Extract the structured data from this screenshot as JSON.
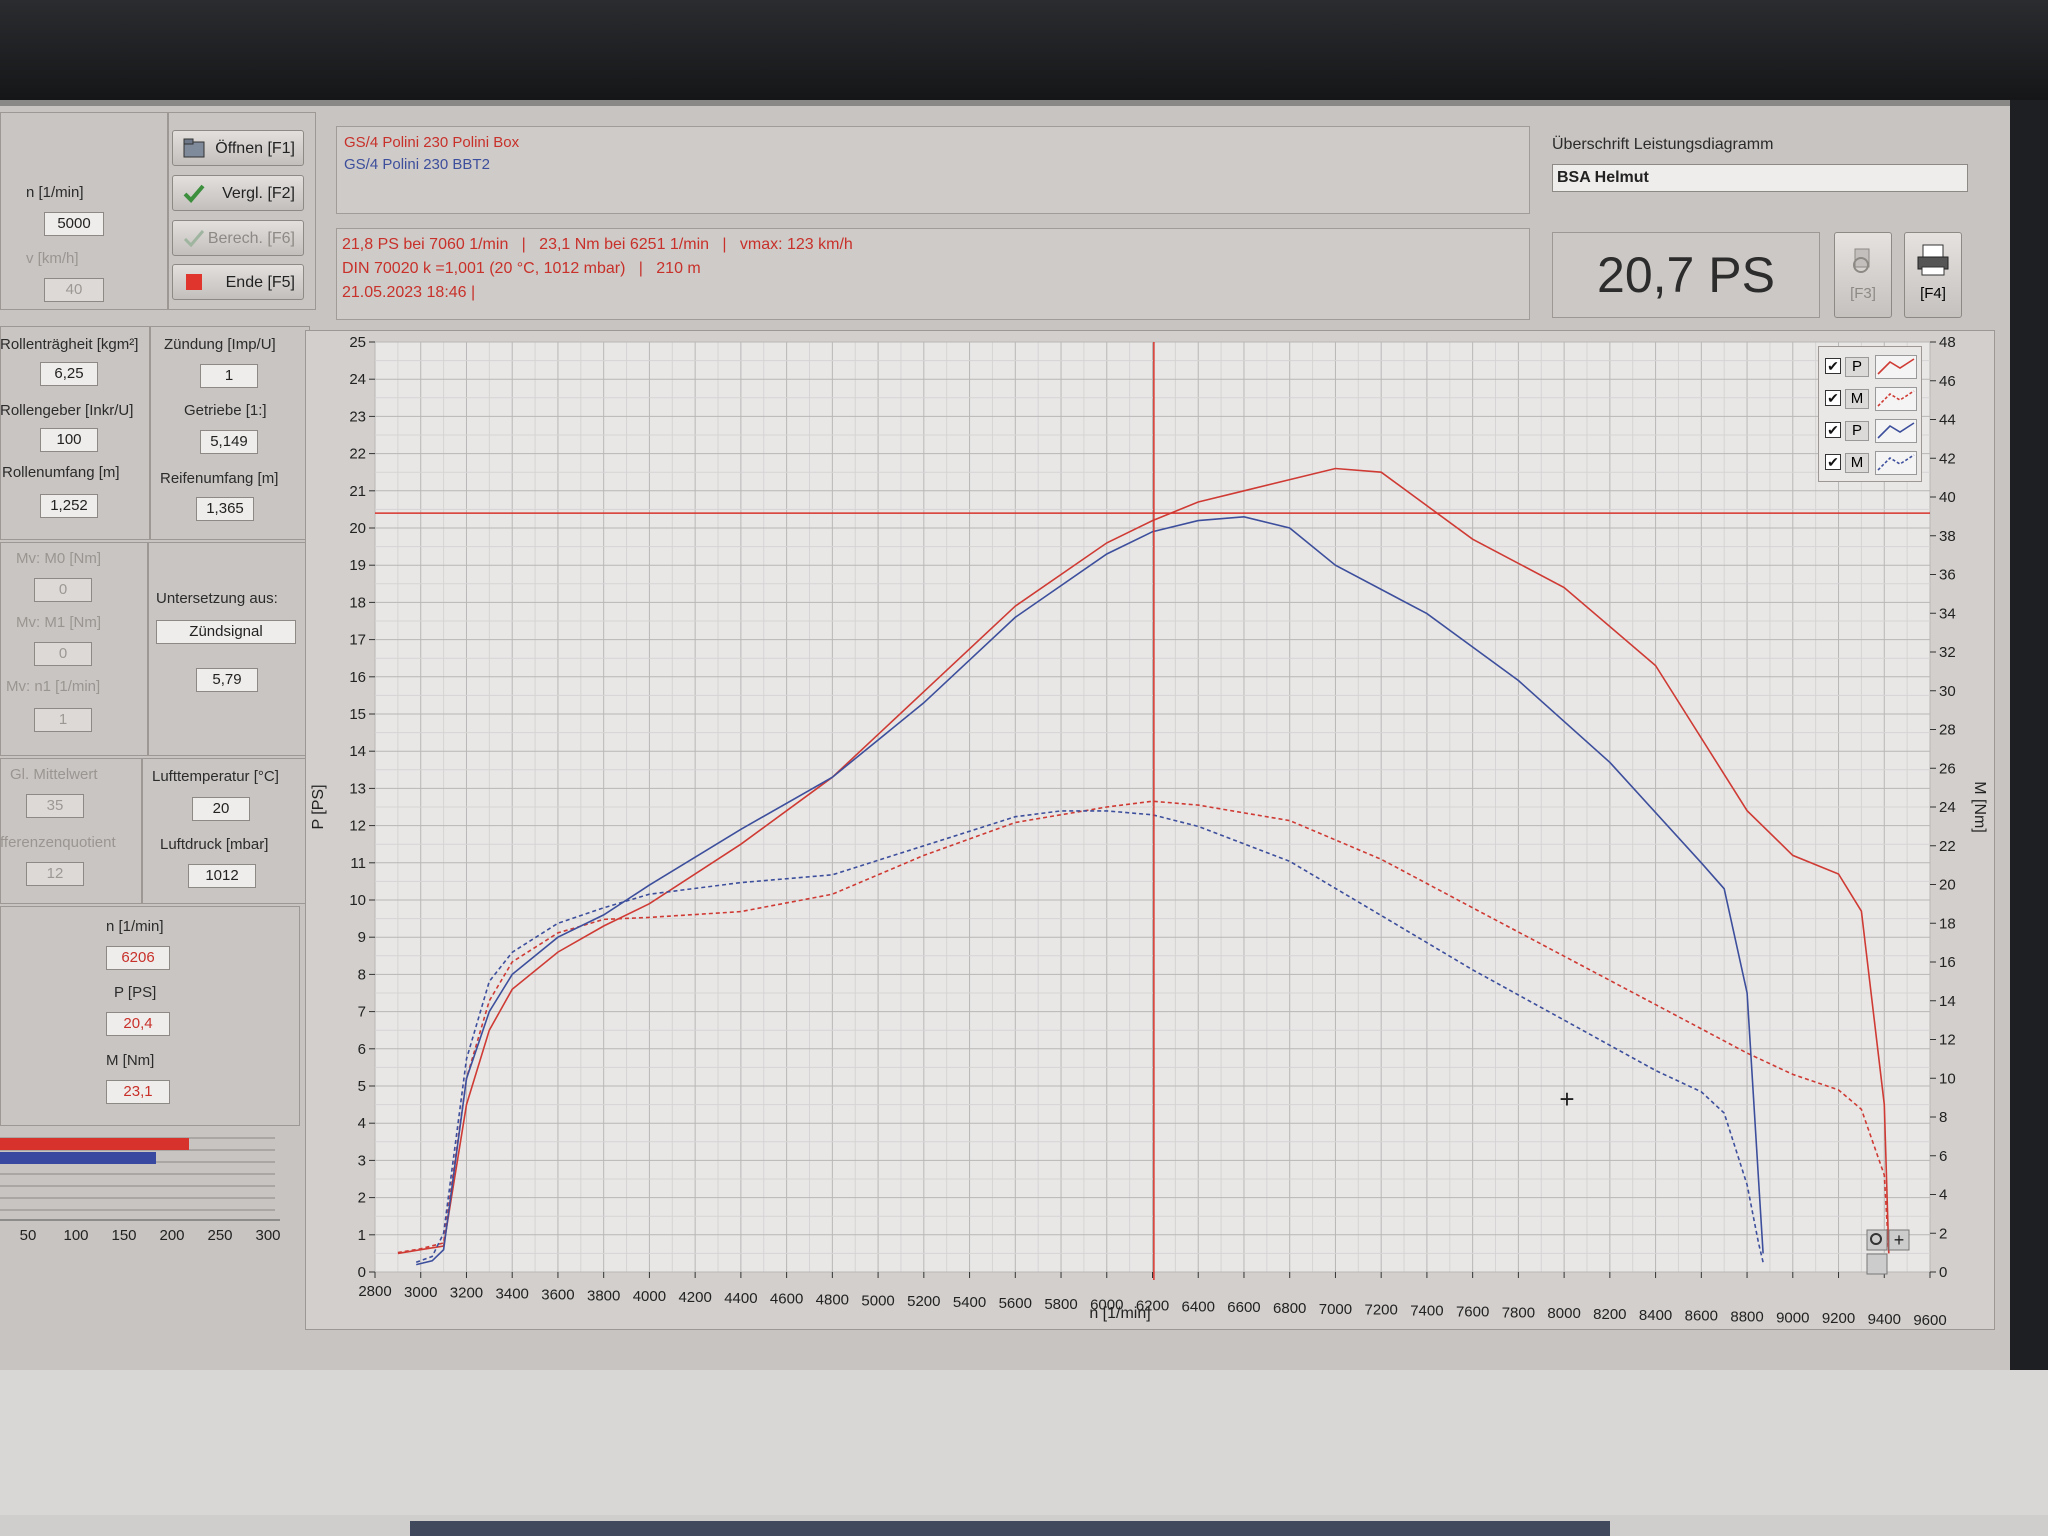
{
  "left": {
    "n_label": "n [1/min]",
    "n_value": "5000",
    "v_label": "v [km/h]",
    "v_value": "40",
    "buttons": {
      "open": "Öffnen [F1]",
      "compare": "Vergl. [F2]",
      "calc": "Berech. [F6]",
      "end": "Ende [F5]"
    },
    "params": {
      "roll_inertia_label": "Rollenträgheit [kgm²]",
      "roll_inertia": "6,25",
      "roll_encoder_label": "Rollengeber [Inkr/U]",
      "roll_encoder": "100",
      "roll_circ_label": "Rollenumfang [m]",
      "roll_circ": "1,252",
      "ignition_label": "Zündung [Imp/U]",
      "ignition": "1",
      "gearbox_label": "Getriebe [1:]",
      "gearbox": "5,149",
      "tire_circ_label": "Reifenumfang [m]",
      "tire_circ": "1,365",
      "mv_m0_label": "Mv: M0 [Nm]",
      "mv_m0": "0",
      "mv_m1_label": "Mv: M1 [Nm]",
      "mv_m1": "0",
      "mv_n1_label": "Mv: n1 [1/min]",
      "mv_n1": "1",
      "reduction_label": "Untersetzung aus:",
      "reduction_source": "Zündsignal",
      "reduction_value": "5,79",
      "gl_mean_label": "Gl. Mittelwert",
      "gl_mean": "35",
      "diff_quot_label": "fferenzenquotient",
      "diff_quot": "12",
      "air_temp_label": "Lufttemperatur [°C]",
      "air_temp": "20",
      "air_press_label": "Luftdruck [mbar]",
      "air_press": "1012"
    },
    "cursor": {
      "n_label": "n [1/min]",
      "n": "6206",
      "p_label": "P [PS]",
      "p": "20,4",
      "m_label": "M [Nm]",
      "m": "23,1"
    },
    "bar_scale": [
      "50",
      "100",
      "150",
      "200",
      "250",
      "300"
    ],
    "bar_levels": {
      "red": 0.63,
      "blue": 0.52
    }
  },
  "header": {
    "file_red": "GS/4 Polini 230 Polini Box",
    "file_blue": "GS/4 Polini 230 BBT2",
    "result_line1": "21,8 PS bei 7060 1/min   |   23,1 Nm bei 6251 1/min   |   vmax: 123 km/h",
    "result_line2": "DIN 70020 k =1,001 (20 °C, 1012 mbar)   |   210 m",
    "result_line3": "21.05.2023 18:46 |",
    "title_label": "Überschrift Leistungsdiagramm",
    "title_value": "BSA Helmut",
    "power_display": "20,7 PS",
    "btn_f3": "[F3]",
    "btn_f4": "[F4]"
  },
  "legend": [
    {
      "label": "P",
      "color": "#cf3b34",
      "dashed": false
    },
    {
      "label": "M",
      "color": "#cf3b34",
      "dashed": true
    },
    {
      "label": "P",
      "color": "#3d4f9c",
      "dashed": false
    },
    {
      "label": "M",
      "color": "#3d4f9c",
      "dashed": true
    }
  ],
  "chart_data": {
    "type": "line",
    "xlabel": "n [1/min]",
    "ylabel": "P [PS]",
    "y2label": "M [Nm]",
    "xlim": [
      2800,
      9600
    ],
    "ylim": [
      0,
      25
    ],
    "y2lim": [
      0,
      48
    ],
    "x_ticks": [
      "2800",
      "3000",
      "3200",
      "3400",
      "3600",
      "3800",
      "4000",
      "4200",
      "4400",
      "4600",
      "4800",
      "5000",
      "5200",
      "5400",
      "5600",
      "5800",
      "6000",
      "6200",
      "6400",
      "6600",
      "6800",
      "7000",
      "7200",
      "7400",
      "7600",
      "7800",
      "8000",
      "8200",
      "8400",
      "8600",
      "8800",
      "9000",
      "9200",
      "9400",
      "9600"
    ],
    "y_ticks": [
      "0",
      "1",
      "2",
      "3",
      "4",
      "5",
      "6",
      "7",
      "8",
      "9",
      "10",
      "11",
      "12",
      "13",
      "14",
      "15",
      "16",
      "17",
      "18",
      "19",
      "20",
      "21",
      "22",
      "23",
      "24",
      "25"
    ],
    "y2_ticks": [
      "0",
      "2",
      "4",
      "6",
      "8",
      "10",
      "12",
      "14",
      "16",
      "18",
      "20",
      "22",
      "24",
      "26",
      "28",
      "30",
      "32",
      "34",
      "36",
      "38",
      "40",
      "42",
      "44",
      "46",
      "48"
    ],
    "cursor": {
      "n": 6206,
      "p": 20.4
    },
    "series": [
      {
        "name": "GS/4 Polini 230 Polini Box",
        "quantity": "P",
        "axis": "left",
        "color": "#cf3b34",
        "dashed": false,
        "x": [
          2900,
          3000,
          3100,
          3200,
          3300,
          3400,
          3600,
          3800,
          4000,
          4400,
          4800,
          5200,
          5600,
          6000,
          6200,
          6400,
          6600,
          7000,
          7200,
          7600,
          8000,
          8400,
          8800,
          9000,
          9200,
          9300,
          9400,
          9420
        ],
        "y": [
          0.5,
          0.6,
          0.7,
          4.5,
          6.5,
          7.6,
          8.6,
          9.3,
          9.9,
          11.5,
          13.3,
          15.6,
          17.9,
          19.6,
          20.2,
          20.7,
          21.0,
          21.6,
          21.5,
          19.7,
          18.4,
          16.3,
          12.4,
          11.2,
          10.7,
          9.7,
          4.5,
          0.5
        ]
      },
      {
        "name": "GS/4 Polini 230 Polini Box",
        "quantity": "M",
        "axis": "right",
        "color": "#cf3b34",
        "dashed": true,
        "x": [
          2900,
          3000,
          3100,
          3200,
          3300,
          3400,
          3600,
          3800,
          4000,
          4400,
          4800,
          5200,
          5600,
          6000,
          6200,
          6400,
          6800,
          7200,
          7600,
          8000,
          8400,
          8800,
          9000,
          9200,
          9300,
          9400,
          9420
        ],
        "y": [
          1,
          1.2,
          1.5,
          10,
          14,
          16,
          17.5,
          18.2,
          18.3,
          18.6,
          19.5,
          21.5,
          23.2,
          24.0,
          24.3,
          24.1,
          23.3,
          21.3,
          18.8,
          16.3,
          13.8,
          11.3,
          10.2,
          9.4,
          8.4,
          5.0,
          1
        ]
      },
      {
        "name": "GS/4 Polini 230 BBT2",
        "quantity": "P",
        "axis": "left",
        "color": "#3d4f9c",
        "dashed": false,
        "x": [
          2980,
          3050,
          3100,
          3200,
          3300,
          3400,
          3600,
          3800,
          4000,
          4400,
          4800,
          5200,
          5600,
          6000,
          6200,
          6400,
          6600,
          6800,
          7000,
          7400,
          7800,
          8200,
          8600,
          8700,
          8800,
          8850,
          8870
        ],
        "y": [
          0.2,
          0.3,
          0.6,
          5.2,
          7.0,
          8.0,
          9.0,
          9.6,
          10.4,
          11.9,
          13.3,
          15.3,
          17.6,
          19.3,
          19.9,
          20.2,
          20.3,
          20.0,
          19.0,
          17.7,
          15.9,
          13.7,
          11.0,
          10.3,
          7.5,
          2.5,
          0.5
        ]
      },
      {
        "name": "GS/4 Polini 230 BBT2",
        "quantity": "M",
        "axis": "right",
        "color": "#3d4f9c",
        "dashed": true,
        "x": [
          2980,
          3050,
          3100,
          3200,
          3300,
          3400,
          3600,
          3800,
          4000,
          4400,
          4800,
          5200,
          5600,
          5800,
          6000,
          6200,
          6400,
          6800,
          7200,
          7600,
          8000,
          8400,
          8600,
          8700,
          8800,
          8850,
          8870
        ],
        "y": [
          0.5,
          0.8,
          2,
          11,
          15,
          16.5,
          18.0,
          18.8,
          19.5,
          20.1,
          20.5,
          22.0,
          23.5,
          23.8,
          23.8,
          23.6,
          23.0,
          21.2,
          18.4,
          15.6,
          13.0,
          10.4,
          9.3,
          8.2,
          4.5,
          1.5,
          0.5
        ]
      }
    ]
  }
}
